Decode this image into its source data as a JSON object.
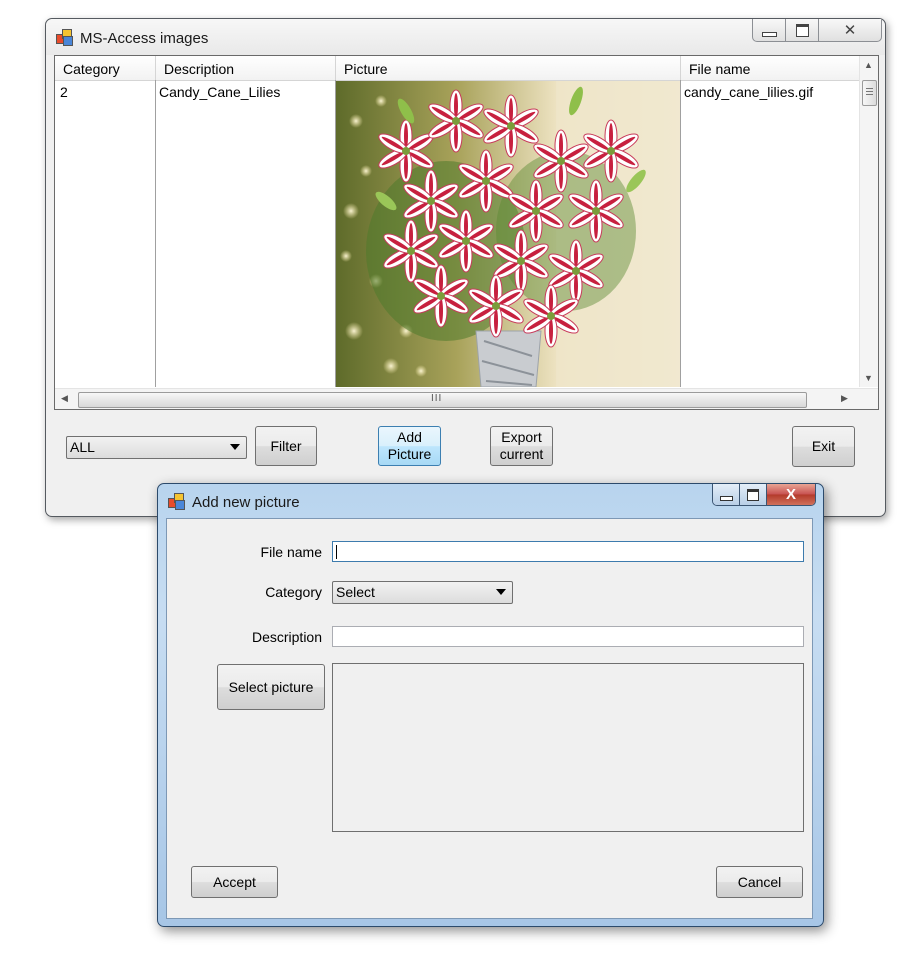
{
  "main_window": {
    "title": "MS-Access images",
    "caption_buttons": {
      "minimize": "▁",
      "maximize": "▭",
      "close": "✕"
    },
    "grid": {
      "columns": [
        "Category",
        "Description",
        "Picture",
        "File name"
      ],
      "rows": [
        {
          "category": "2",
          "description": "Candy_Cane_Lilies",
          "file_name": "candy_cane_lilies.gif"
        }
      ],
      "hscroll_grip": "III"
    },
    "filter_combo": {
      "selected": "ALL"
    },
    "buttons": {
      "filter": "Filter",
      "add_picture_line1": "Add",
      "add_picture_line2": "Picture",
      "export_line1": "Export",
      "export_line2": "current",
      "exit": "Exit"
    }
  },
  "dialog": {
    "title": "Add new picture",
    "caption_buttons": {
      "minimize": "▁",
      "maximize": "▭",
      "close": "X"
    },
    "labels": {
      "file_name": "File name",
      "category": "Category",
      "description": "Description"
    },
    "fields": {
      "file_name_value": "",
      "category_selected": "Select",
      "description_value": ""
    },
    "buttons": {
      "select_picture": "Select picture",
      "accept": "Accept",
      "cancel": "Cancel"
    }
  },
  "colors": {
    "window_bg": "#f0f0f0",
    "dialog_frame": "#b8d4ee",
    "focused_button": "#bee6fd",
    "close_red": "#c75050"
  }
}
